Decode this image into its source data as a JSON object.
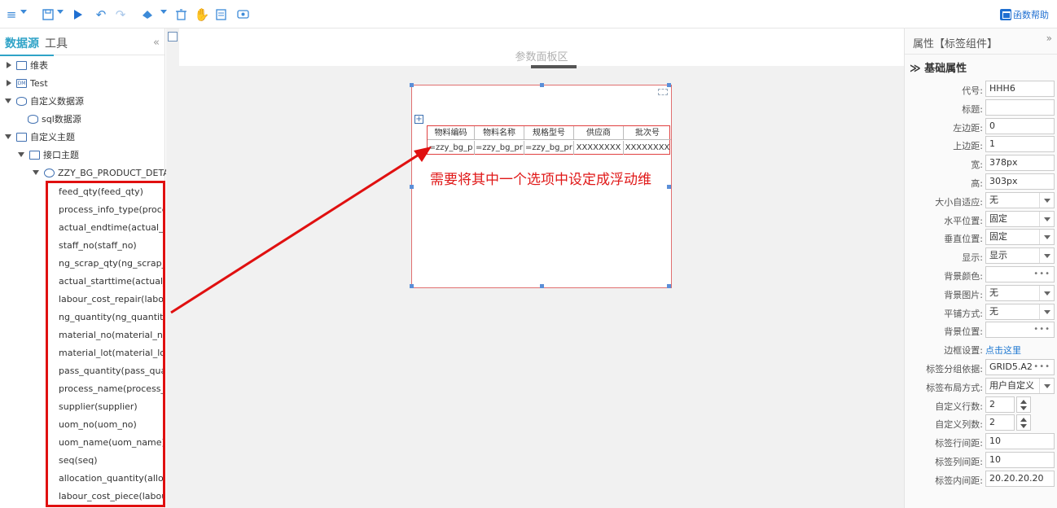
{
  "toolbar": {
    "help_label": "函数帮助",
    "icons": [
      "menu-icon",
      "save-icon",
      "run-icon",
      "undo-icon",
      "redo-icon",
      "brush-icon",
      "delete-icon",
      "hand-icon",
      "template-icon",
      "preview-icon"
    ]
  },
  "left_panel": {
    "tabs": [
      "数据源",
      "工具"
    ],
    "collapse_glyph": "«",
    "tree": [
      {
        "label": "维表",
        "icon": "table-icon"
      },
      {
        "label": "Test",
        "icon": "dimension-icon"
      },
      {
        "label": "自定义数据源",
        "icon": "database-icon"
      },
      {
        "label": "sql数据源",
        "icon": "sql-icon"
      },
      {
        "label": "自定义主题",
        "icon": "theme-icon"
      },
      {
        "label": "接口主题",
        "icon": "folder-icon"
      },
      {
        "label": "ZZY_BG_PRODUCT_DETA",
        "icon": "link-icon"
      }
    ],
    "fields": [
      "feed_qty(feed_qty)",
      "process_info_type(proces",
      "actual_endtime(actual_er",
      "staff_no(staff_no)",
      "ng_scrap_qty(ng_scrap_c",
      "actual_starttime(actual_s",
      "labour_cost_repair(labou",
      "ng_quantity(ng_quantity",
      "material_no(material_no)",
      "material_lot(material_lot)",
      "pass_quantity(pass_quan",
      "process_name(process_n",
      "supplier(supplier)",
      "uom_no(uom_no)",
      "uom_name(uom_name)",
      "seq(seq)",
      "allocation_quantity(alloc",
      "labour_cost_piece(labou"
    ]
  },
  "center": {
    "param_area_label": "参数面板区",
    "table": {
      "headers": [
        "物料编码",
        "物料名称",
        "规格型号",
        "供应商",
        "批次号"
      ],
      "row": [
        "=zzy_bg_p",
        "=zzy_bg_pr",
        "=zzy_bg_pr",
        "XXXXXXXX",
        "XXXXXXXX"
      ]
    },
    "annotation": "需要将其中一个选项中设定成浮动维",
    "annotation_color": "#e01818"
  },
  "right_panel": {
    "title": "属性【标签组件】",
    "expand_glyph": "»",
    "section": "≫ 基础属性",
    "props": [
      {
        "label": "代号:",
        "value": "HHH6",
        "kind": "input"
      },
      {
        "label": "标题:",
        "value": "",
        "kind": "input"
      },
      {
        "label": "左边距:",
        "value": "0",
        "kind": "input"
      },
      {
        "label": "上边距:",
        "value": "1",
        "kind": "input"
      },
      {
        "label": "宽:",
        "value": "378px",
        "kind": "input"
      },
      {
        "label": "高:",
        "value": "303px",
        "kind": "input"
      },
      {
        "label": "大小自适应:",
        "value": "无",
        "kind": "select"
      },
      {
        "label": "水平位置:",
        "value": "固定",
        "kind": "select"
      },
      {
        "label": "垂直位置:",
        "value": "固定",
        "kind": "select"
      },
      {
        "label": "显示:",
        "value": "显示",
        "kind": "select"
      },
      {
        "label": "背景颜色:",
        "value": "",
        "kind": "dots"
      },
      {
        "label": "背景图片:",
        "value": "无",
        "kind": "select"
      },
      {
        "label": "平铺方式:",
        "value": "无",
        "kind": "select"
      },
      {
        "label": "背景位置:",
        "value": "",
        "kind": "dots"
      },
      {
        "label": "边框设置:",
        "value": "点击这里",
        "kind": "link"
      },
      {
        "label": "标签分组依据:",
        "value": "GRID5.A2",
        "kind": "dots"
      },
      {
        "label": "标签布局方式:",
        "value": "用户自定义",
        "kind": "select"
      },
      {
        "label": "自定义行数:",
        "value": "2",
        "kind": "spin"
      },
      {
        "label": "自定义列数:",
        "value": "2",
        "kind": "spin"
      },
      {
        "label": "标签行间距:",
        "value": "10",
        "kind": "input"
      },
      {
        "label": "标签列间距:",
        "value": "10",
        "kind": "input"
      },
      {
        "label": "标签内间距:",
        "value": "20.20.20.20",
        "kind": "input"
      }
    ]
  },
  "colors": {
    "accent": "#2fa3c7",
    "highlight": "#e01010",
    "link": "#1f78d1"
  }
}
